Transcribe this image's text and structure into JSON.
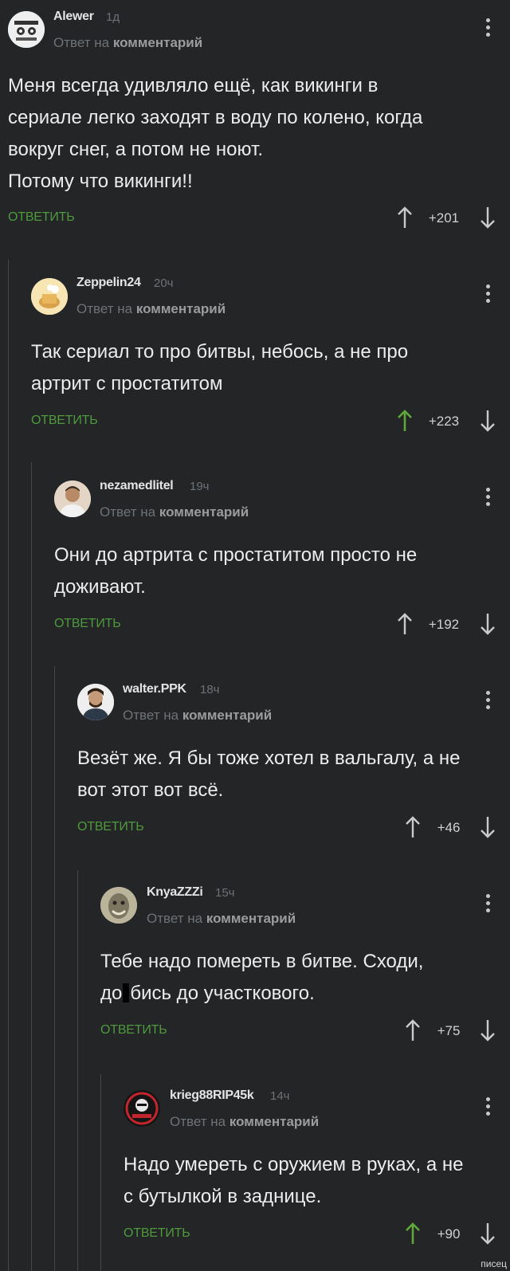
{
  "reply_to_prefix": "Ответ на",
  "reply_to_target": "комментарий",
  "reply_label": "ОТВЕТИТЬ",
  "watermark": "писец",
  "comments": [
    {
      "username": "Alewer",
      "time": "1д",
      "text": "Меня всегда удивляло ещё, как викинги в\nсериале легко заходят в воду по колено, когда\nвокруг снег, а потом не ноют.\nПотому что викинги!!",
      "rating": "+201",
      "upvoted": false
    },
    {
      "username": "Zeppelin24",
      "time": "20ч",
      "text": "Так сериал то про битвы, небось, а не про\nартрит с простатитом",
      "rating": "+223",
      "upvoted": true
    },
    {
      "username": "nezamedlitel",
      "time": "19ч",
      "text": "Они до артрита с простатитом просто не\nдоживают.",
      "rating": "+192",
      "upvoted": false
    },
    {
      "username": "walter.PPK",
      "time": "18ч",
      "text": "Везёт же. Я бы тоже хотел в вальгалу, а не\nвот этот вот всё.",
      "rating": "+46",
      "upvoted": false
    },
    {
      "username": "KnyaZZZi",
      "time": "15ч",
      "text_part1": "Тебе надо помереть в битве. Сходи,\nдо",
      "text_part2": "бись до участкового.",
      "rating": "+75",
      "upvoted": false
    },
    {
      "username": "krieg88RIP45k",
      "time": "14ч",
      "text": "Надо умереть с оружием в руках, а не\nс бутылкой в заднице.",
      "rating": "+90",
      "upvoted": true
    }
  ],
  "icons": {
    "vote_up": "arrow-up-icon",
    "vote_down": "arrow-down-icon",
    "menu": "more-vertical-icon"
  },
  "colors": {
    "background": "#232527",
    "reply_green": "#4e9a3d",
    "upvoted_green": "#5fa83a",
    "muted": "#6f7275"
  }
}
